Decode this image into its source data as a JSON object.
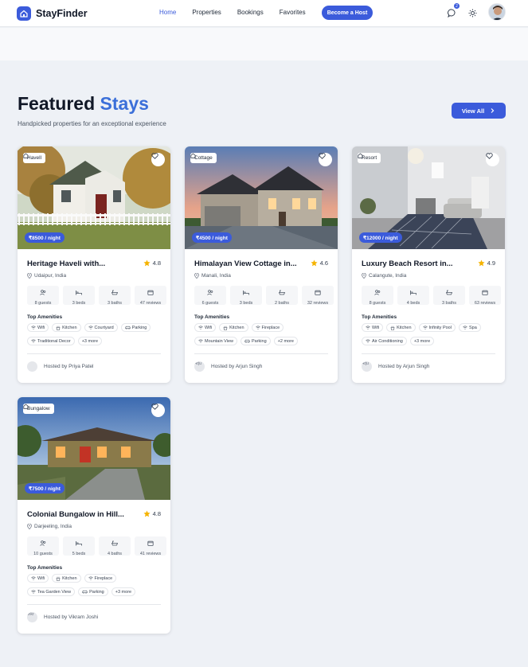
{
  "nav": {
    "brand": "StayFinder",
    "links": [
      "Home",
      "Properties",
      "Bookings",
      "Favorites"
    ],
    "host_button": "Become a Host",
    "notification_count": "2"
  },
  "hero": {
    "title_part1": "Featured",
    "title_part2": "Stays",
    "subtitle": "Handpicked properties for an exceptional experience",
    "view_all": "View All"
  },
  "amenities_heading": "Top Amenities",
  "colors": {
    "accent": "#3b5bdb",
    "star": "#f5b301"
  },
  "cards": [
    {
      "tag": "Havell",
      "price": "₹8500 / night",
      "title": "Heritage Haveli with...",
      "rating": "4.8",
      "location": "Udaipur, India",
      "stats": [
        "8 guests",
        "3 beds",
        "3 baths",
        "47 reviews"
      ],
      "amenities": [
        "Wifi",
        "Kitchen",
        "Courtyard",
        "Parking",
        "Traditional Decor",
        "+3 more"
      ],
      "host": "Hosted by Priya Patel",
      "host_avatar_alt": ""
    },
    {
      "tag": "Cottage",
      "price": "₹4500 / night",
      "title": "Himalayan View Cottage in...",
      "rating": "4.6",
      "location": "Manali, India",
      "stats": [
        "6 guests",
        "3 beds",
        "2 baths",
        "32 reviews"
      ],
      "amenities": [
        "Wifi",
        "Kitchen",
        "Fireplace",
        "Mountain View",
        "Parking",
        "+2 more"
      ],
      "host": "Hosted by Arjun Singh",
      "host_avatar_alt": "Arju"
    },
    {
      "tag": "Resort",
      "price": "₹12000 / night",
      "title": "Luxury Beach Resort in...",
      "rating": "4.9",
      "location": "Calangute, India",
      "stats": [
        "8 guests",
        "4 beds",
        "3 baths",
        "63 reviews"
      ],
      "amenities": [
        "Wifi",
        "Kitchen",
        "Infinity Pool",
        "Spa",
        "Air Conditioning",
        "+3 more"
      ],
      "host": "Hosted by Arjun Singh",
      "host_avatar_alt": "Arju"
    },
    {
      "tag": "Bungalow",
      "price": "₹7500 / night",
      "title": "Colonial Bungalow in Hill...",
      "rating": "4.8",
      "location": "Darjeeling, India",
      "stats": [
        "10 guests",
        "5 beds",
        "4 baths",
        "41 reviews"
      ],
      "amenities": [
        "Wifi",
        "Kitchen",
        "Fireplace",
        "Tea Garden View",
        "Parking",
        "+3 more"
      ],
      "host": "Hosted by Vikram Joshi",
      "host_avatar_alt": "Vikr"
    }
  ]
}
